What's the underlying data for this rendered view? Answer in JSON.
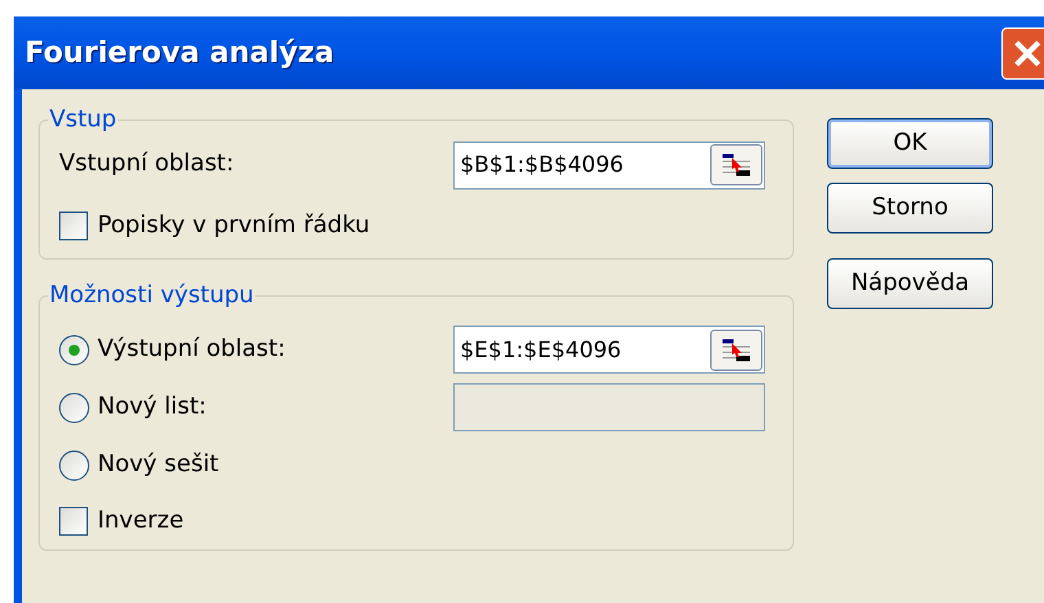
{
  "window": {
    "title": "Fourierova analýza"
  },
  "input_group": {
    "legend": "Vstup",
    "range_label": "Vstupní oblast:",
    "range_value": "$B$1:$B$4096",
    "labels_checkbox": {
      "label": "Popisky v prvním řádku",
      "checked": false
    }
  },
  "output_group": {
    "legend": "Možnosti výstupu",
    "options": [
      {
        "label": "Výstupní oblast:",
        "selected": true,
        "field": {
          "value": "$E$1:$E$4096",
          "disabled": false
        }
      },
      {
        "label": "Nový list:",
        "selected": false,
        "field": {
          "disabled": true
        }
      },
      {
        "label": "Nový sešit",
        "selected": false
      }
    ],
    "inverse_checkbox": {
      "label": "Inverze",
      "checked": false
    }
  },
  "buttons": [
    "OK",
    "Storno",
    "Nápověda"
  ]
}
